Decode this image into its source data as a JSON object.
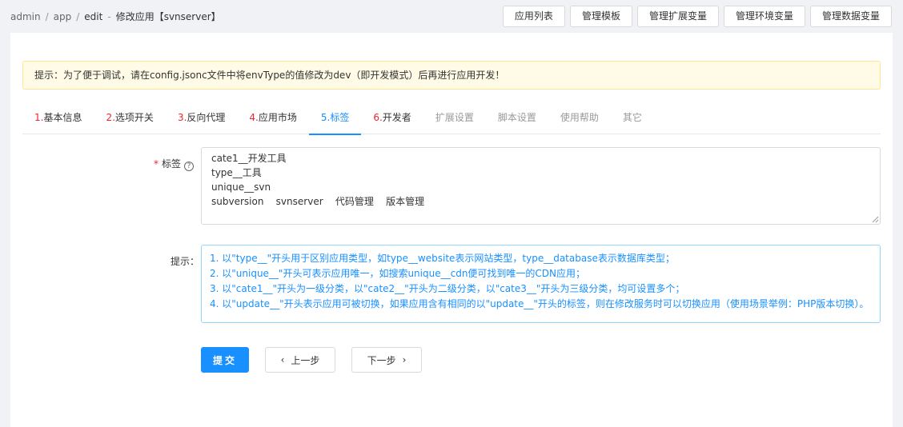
{
  "breadcrumb": {
    "items": [
      "admin",
      "app",
      "edit"
    ],
    "separator": "/",
    "current": "修改应用【svnserver】",
    "current_sep": "-"
  },
  "top_actions": [
    "应用列表",
    "管理模板",
    "管理扩展变量",
    "管理环境变量",
    "管理数据变量"
  ],
  "notice": "提示：为了便于调试，请在config.jsonc文件中将envType的值修改为dev（即开发模式）后再进行应用开发！",
  "tabs": [
    {
      "num": "1.",
      "label": "基本信息",
      "state": "normal"
    },
    {
      "num": "2.",
      "label": "选项开关",
      "state": "normal"
    },
    {
      "num": "3.",
      "label": "反向代理",
      "state": "normal"
    },
    {
      "num": "4.",
      "label": "应用市场",
      "state": "normal"
    },
    {
      "num": "5.",
      "label": "标签",
      "state": "active"
    },
    {
      "num": "6.",
      "label": "开发者",
      "state": "normal"
    },
    {
      "num": "",
      "label": "扩展设置",
      "state": "disabled"
    },
    {
      "num": "",
      "label": "脚本设置",
      "state": "disabled"
    },
    {
      "num": "",
      "label": "使用帮助",
      "state": "disabled"
    },
    {
      "num": "",
      "label": "其它",
      "state": "disabled"
    }
  ],
  "form": {
    "tags_label": "标签",
    "required_mark": "*",
    "help_glyph": "?",
    "tags_value": "cate1__开发工具\ntype__工具\nunique__svn\nsubversion    svnserver    代码管理    版本管理",
    "hint_label": "提示：",
    "hints": [
      "1. 以\"type__\"开头用于区别应用类型，如type__website表示网站类型，type__database表示数据库类型；",
      "2. 以\"unique__\"开头可表示应用唯一，如搜索unique__cdn便可找到唯一的CDN应用；",
      "3. 以\"cate1__\"开头为一级分类，以\"cate2__\"开头为二级分类，以\"cate3__\"开头为三级分类，均可设置多个；",
      "4. 以\"update__\"开头表示应用可被切换，如果应用含有相同的以\"update__\"开头的标签，则在修改服务时可以切换应用（使用场景举例：PHP版本切换）。"
    ]
  },
  "buttons": {
    "submit": "提交",
    "prev": "上一步",
    "next": "下一步",
    "prev_glyph": "‹",
    "next_glyph": "›"
  },
  "colors": {
    "primary": "#1890ff",
    "required": "#f5222d",
    "notice_bg": "#fffbe6",
    "notice_border": "#ffe58f"
  }
}
